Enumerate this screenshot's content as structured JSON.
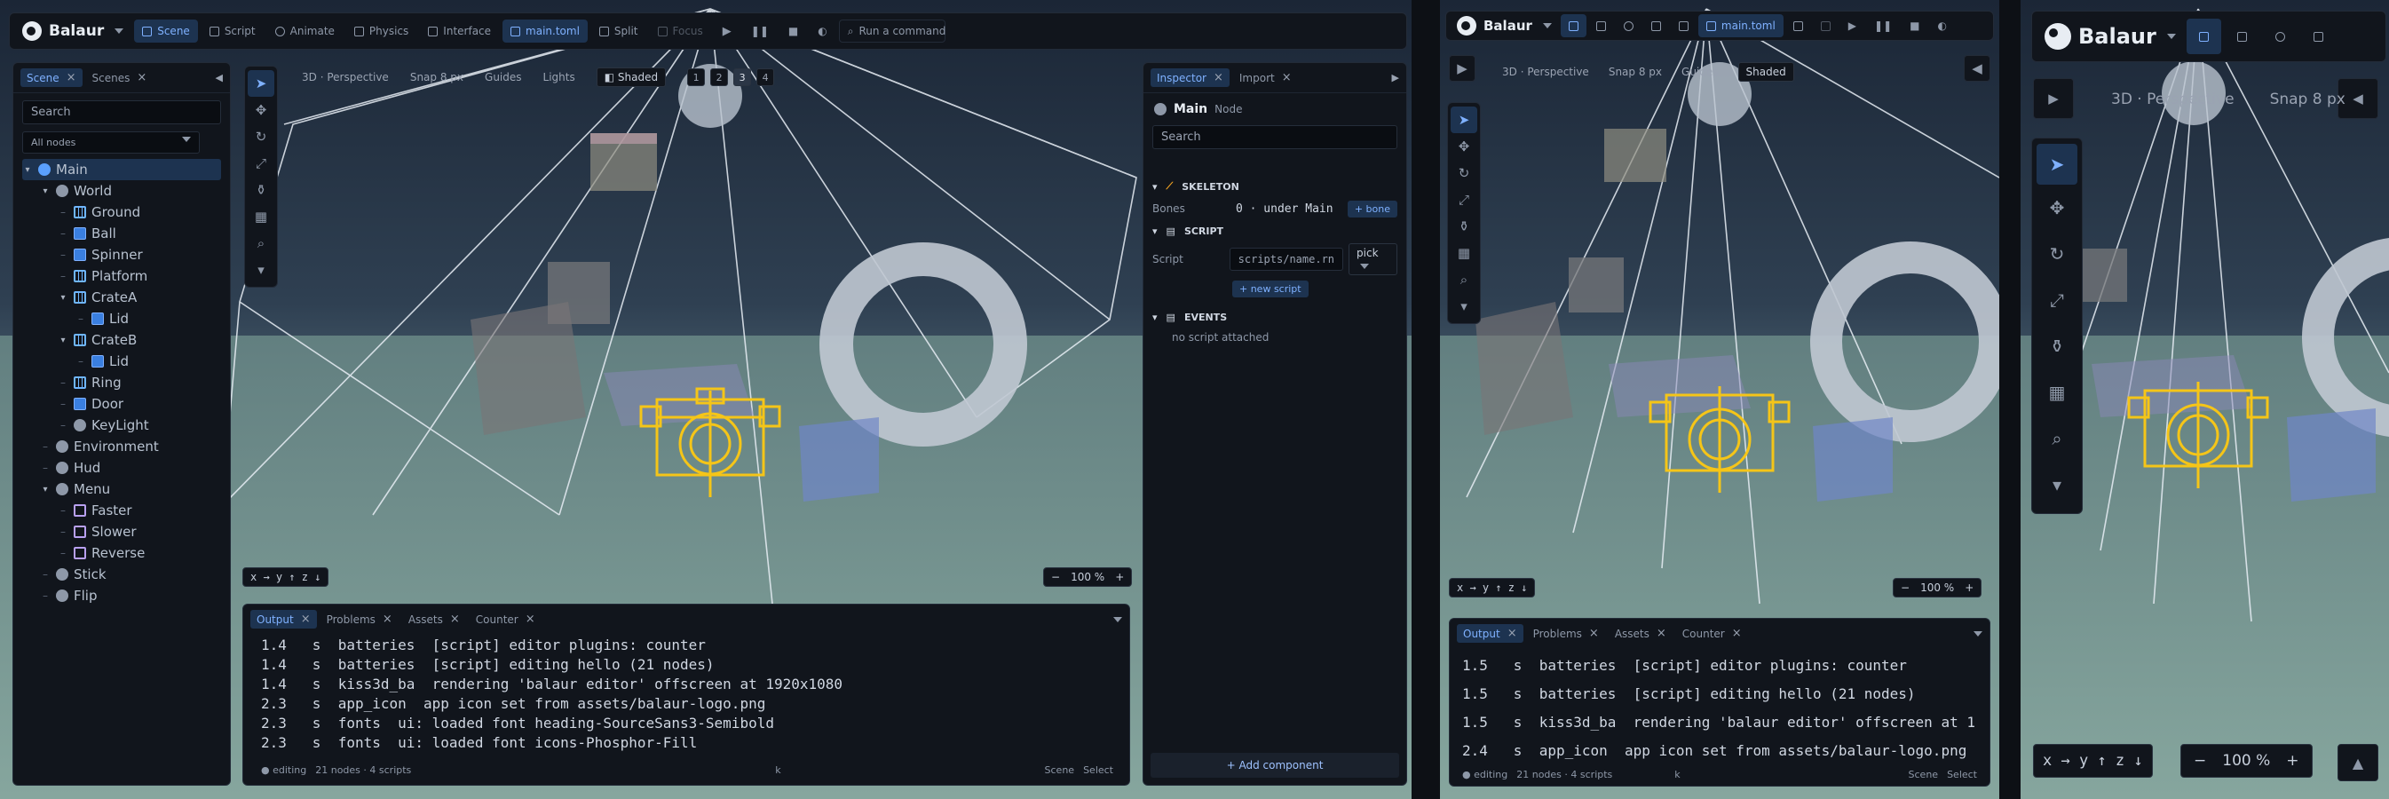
{
  "app": {
    "name": "Balaur",
    "file": "main.toml",
    "run_placeholder": "Run a command"
  },
  "topbar": {
    "modes": [
      "Scene",
      "Script",
      "Animate",
      "Physics",
      "Interface"
    ],
    "split": "Split",
    "focus": "Focus"
  },
  "outliner": {
    "tabs": [
      "Scene",
      "Scenes"
    ],
    "search_placeholder": "Search",
    "filter": "All nodes",
    "nodes": [
      {
        "label": "Main",
        "depth": 0,
        "icon": "dot-blue",
        "toggle": "▾",
        "selected": true
      },
      {
        "label": "World",
        "depth": 1,
        "icon": "dot",
        "toggle": "▾"
      },
      {
        "label": "Ground",
        "depth": 2,
        "icon": "grid"
      },
      {
        "label": "Ball",
        "depth": 2,
        "icon": "box"
      },
      {
        "label": "Spinner",
        "depth": 2,
        "icon": "box"
      },
      {
        "label": "Platform",
        "depth": 2,
        "icon": "grid"
      },
      {
        "label": "CrateA",
        "depth": 2,
        "icon": "grid",
        "toggle": "▾"
      },
      {
        "label": "Lid",
        "depth": 3,
        "icon": "box"
      },
      {
        "label": "CrateB",
        "depth": 2,
        "icon": "grid",
        "toggle": "▾"
      },
      {
        "label": "Lid",
        "depth": 3,
        "icon": "box"
      },
      {
        "label": "Ring",
        "depth": 2,
        "icon": "grid"
      },
      {
        "label": "Door",
        "depth": 2,
        "icon": "box"
      },
      {
        "label": "KeyLight",
        "depth": 2,
        "icon": "dot"
      },
      {
        "label": "Environment",
        "depth": 1,
        "icon": "dot"
      },
      {
        "label": "Hud",
        "depth": 1,
        "icon": "dot"
      },
      {
        "label": "Menu",
        "depth": 1,
        "icon": "dot",
        "toggle": "▾"
      },
      {
        "label": "Faster",
        "depth": 2,
        "icon": "ui"
      },
      {
        "label": "Slower",
        "depth": 2,
        "icon": "ui"
      },
      {
        "label": "Reverse",
        "depth": 2,
        "icon": "ui"
      },
      {
        "label": "Stick",
        "depth": 1,
        "icon": "dot"
      },
      {
        "label": "Flip",
        "depth": 1,
        "icon": "dot"
      }
    ]
  },
  "viewport": {
    "view": "3D · Perspective",
    "snap": "Snap 8 px",
    "guides": "Guides",
    "lights": "Lights",
    "shaded": "Shaded",
    "cams": [
      "1",
      "2",
      "3",
      "4"
    ],
    "axes": "x → y ↑ z ↓",
    "zoom": "100 %",
    "zoom_minus": "−",
    "zoom_plus": "+"
  },
  "inspector": {
    "tabs": [
      "Inspector",
      "Import"
    ],
    "node_name": "Main",
    "node_type": "Node",
    "search_placeholder": "Search",
    "skeleton": {
      "title": "SKELETON",
      "bones_label": "Bones",
      "bones_value": "0 · under Main",
      "add_bone": "+ bone"
    },
    "script": {
      "title": "SCRIPT",
      "label": "Script",
      "path": "scripts/name.rn",
      "pick": "pick",
      "new": "+ new script"
    },
    "events": {
      "title": "EVENTS",
      "empty": "no script attached"
    },
    "add_component": "+ Add component"
  },
  "console": {
    "tabs": [
      "Output",
      "Problems",
      "Assets",
      "Counter"
    ],
    "lines": [
      "1.4   s  batteries  [script] editor plugins: counter",
      "1.4   s  batteries  [script] editing hello (21 nodes)",
      "1.4   s  kiss3d_ba  rendering 'balaur editor' offscreen at 1920x1080",
      "2.3   s  app_icon  app icon set from assets/balaur-logo.png",
      "2.3   s  fonts  ui: loaded font heading-SourceSans3-Semibold",
      "2.3   s  fonts  ui: loaded font icons-Phosphor-Fill"
    ],
    "status_left": "● editing",
    "status_counts": "21 nodes · 4 scripts",
    "status_mid": "k",
    "status_scene": "Scene",
    "status_select": "Select"
  },
  "console_mid": {
    "lines": [
      "1.5   s  batteries  [script] editor plugins: counter",
      "1.5   s  batteries  [script] editing hello (21 nodes)",
      "1.5   s  kiss3d_ba  rendering 'balaur editor' offscreen at 1",
      "2.4   s  app_icon  app icon set from assets/balaur-logo.png"
    ]
  }
}
